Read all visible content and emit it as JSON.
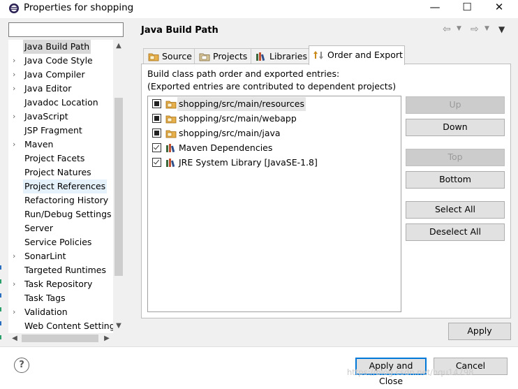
{
  "window": {
    "title": "Properties for shopping",
    "minimize_glyph": "—",
    "maximize_glyph": "☐",
    "close_glyph": "✕"
  },
  "filter": {
    "value": "",
    "placeholder": ""
  },
  "tree": {
    "items": [
      {
        "label": "Java Build Path",
        "expandable": false,
        "selected": true
      },
      {
        "label": "Java Code Style",
        "expandable": true
      },
      {
        "label": "Java Compiler",
        "expandable": true
      },
      {
        "label": "Java Editor",
        "expandable": true
      },
      {
        "label": "Javadoc Location",
        "expandable": false
      },
      {
        "label": "JavaScript",
        "expandable": true
      },
      {
        "label": "JSP Fragment",
        "expandable": false
      },
      {
        "label": "Maven",
        "expandable": true
      },
      {
        "label": "Project Facets",
        "expandable": false
      },
      {
        "label": "Project Natures",
        "expandable": false
      },
      {
        "label": "Project References",
        "expandable": false,
        "hover": true
      },
      {
        "label": "Refactoring History",
        "expandable": false
      },
      {
        "label": "Run/Debug Settings",
        "expandable": false
      },
      {
        "label": "Server",
        "expandable": false
      },
      {
        "label": "Service Policies",
        "expandable": false
      },
      {
        "label": "SonarLint",
        "expandable": true
      },
      {
        "label": "Targeted Runtimes",
        "expandable": false
      },
      {
        "label": "Task Repository",
        "expandable": true
      },
      {
        "label": "Task Tags",
        "expandable": false
      },
      {
        "label": "Validation",
        "expandable": true
      },
      {
        "label": "Web Content Settings",
        "expandable": false
      }
    ]
  },
  "page": {
    "title": "Java Build Path",
    "nav": {
      "back": "⇦",
      "forward": "⇨",
      "menu": "▼"
    }
  },
  "tabs": [
    {
      "label": "Source",
      "icon": "source-folder-icon",
      "active": false
    },
    {
      "label": "Projects",
      "icon": "projects-icon",
      "active": false
    },
    {
      "label": "Libraries",
      "icon": "libraries-icon",
      "active": false
    },
    {
      "label": "Order and Export",
      "icon": "order-export-icon",
      "active": true
    }
  ],
  "order_export": {
    "description_line1": "Build class path order and exported entries:",
    "description_line2": "(Exported entries are contributed to dependent projects)",
    "entries": [
      {
        "label": "shopping/src/main/resources",
        "icon": "source-folder-icon",
        "state": "filled",
        "selected": true
      },
      {
        "label": "shopping/src/main/webapp",
        "icon": "source-folder-icon",
        "state": "filled"
      },
      {
        "label": "shopping/src/main/java",
        "icon": "source-folder-icon",
        "state": "filled"
      },
      {
        "label": "Maven Dependencies",
        "icon": "library-icon",
        "state": "checked"
      },
      {
        "label": "JRE System Library [JavaSE-1.8]",
        "icon": "library-icon",
        "state": "checked"
      }
    ],
    "buttons": {
      "up": "Up",
      "down": "Down",
      "top": "Top",
      "bottom": "Bottom",
      "select_all": "Select All",
      "deselect_all": "Deselect All"
    }
  },
  "apply_label": "Apply",
  "footer": {
    "help": "?",
    "apply_and_close": "Apply and Close",
    "cancel": "Cancel",
    "watermark": "https://blog.csdn.net/hqu14798"
  },
  "colors": {
    "accent": "#0078d7",
    "panel_bg": "#f0f0f0",
    "selection": "#d9d9d9",
    "folder": "#e8b04a"
  }
}
